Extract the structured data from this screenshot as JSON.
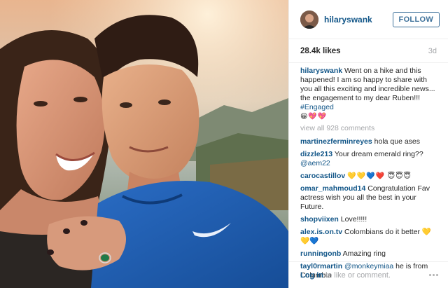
{
  "post": {
    "username": "hilaryswank",
    "follow_label": "FOLLOW",
    "likes": "28.4k likes",
    "time_ago": "3d"
  },
  "caption": {
    "user": "hilaryswank",
    "text": "Went on a hike and this happened! I am so happy to share with you all this exciting and incredible news... the engagement to my dear Ruben!!! ",
    "hashtag": "#Engaged",
    "emoji": "😀💖💖"
  },
  "view_all": "view all 928 comments",
  "comments": [
    {
      "user": "martinezferminreyes",
      "text": "hola que ases"
    },
    {
      "user": "dizzle213",
      "text": "Your dream emerald ring??",
      "mention": "@aem22"
    },
    {
      "user": "carocastillov",
      "text": "💛💛💙❤️ 😇😇😇"
    },
    {
      "user": "omar_mahmoud14",
      "text": "Congratulation Fav actress wish you all the best in your Future."
    },
    {
      "user": "shopviixen",
      "text": "Love!!!!!"
    },
    {
      "user": "alex.is.on.tv",
      "text": "Colombians do it better 💛💛💙"
    },
    {
      "user": "runningonb",
      "text": "Amazing ring"
    },
    {
      "user": "tayl0rmartin",
      "mention": "@monkeymiaa",
      "text": " he is from Columbia"
    }
  ],
  "footer": {
    "login_link": "Log in",
    "login_suffix": " to like or comment."
  },
  "icons": {
    "more": "more-options-icon"
  },
  "colors": {
    "link": "#125688",
    "follow": "#3f729b",
    "muted": "#a5a7aa"
  }
}
